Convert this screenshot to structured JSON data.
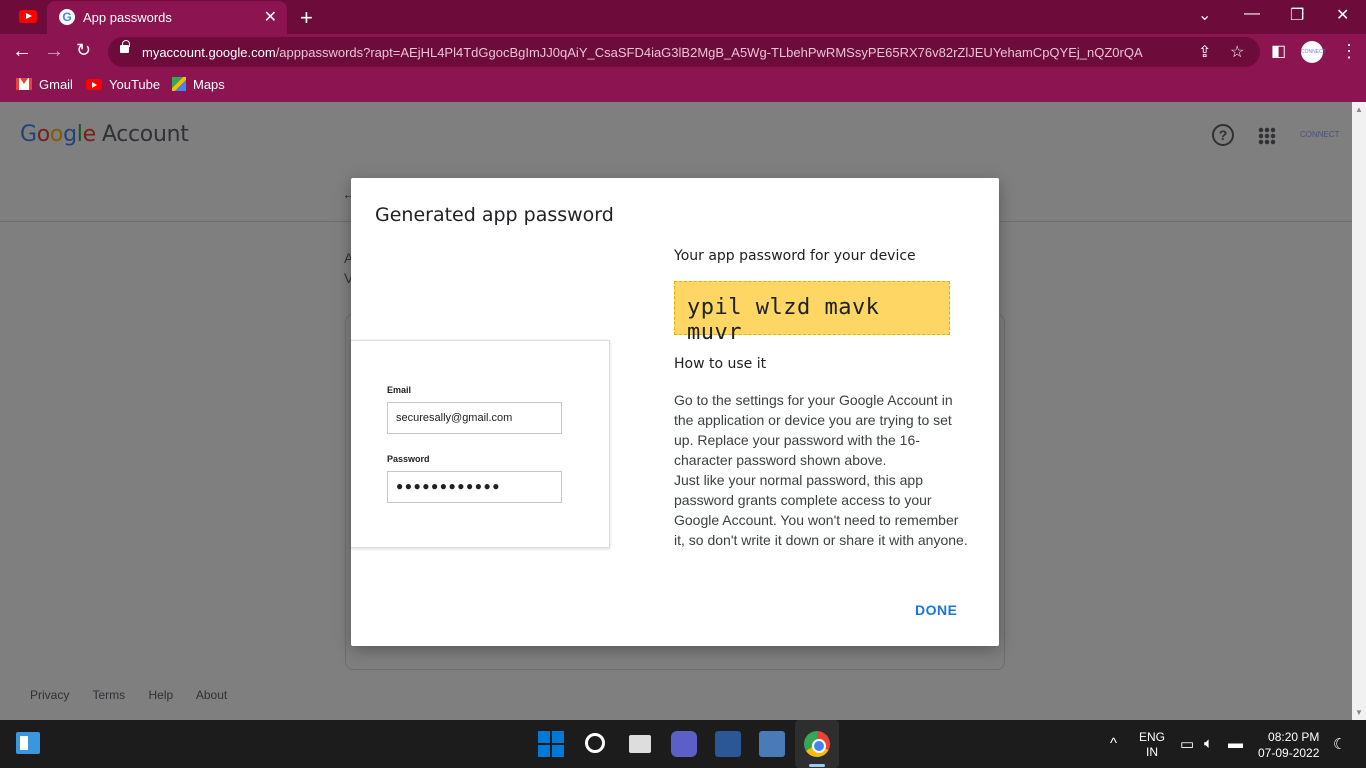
{
  "browser": {
    "tab_title": "App passwords",
    "url_host": "myaccount.google.com",
    "url_path": "/apppasswords?rapt=AEjHL4Pl4TdGgocBgImJJ0qAiY_CsaSFD4iaG3lB2MgB_A5Wg-TLbehPwRMSsyPE65RX76v82rZlJEUYehamCpQYEj_nQZ0rQA",
    "bookmarks": [
      "Gmail",
      "YouTube",
      "Maps"
    ]
  },
  "page": {
    "logo_google": "Google",
    "logo_account": "Account",
    "bg_text_1": "A",
    "bg_text_2": "V",
    "footer": [
      "Privacy",
      "Terms",
      "Help",
      "About"
    ]
  },
  "dialog": {
    "title": "Generated app password",
    "subtitle": "Your app password for your device",
    "password": "ypil wlzd mavk muvr",
    "how_to_title": "How to use it",
    "instructions_1": "Go to the settings for your Google Account in the application or device you are trying to set up. Replace your password with the 16-character password shown above.",
    "instructions_2": "Just like your normal password, this app password grants complete access to your Google Account. You won't need to remember it, so don't write it down or share it with anyone.",
    "done_label": "DONE",
    "preview": {
      "email_label": "Email",
      "email_value": "securesally@gmail.com",
      "password_label": "Password",
      "password_value": "●●●●●●●●●●●●"
    }
  },
  "taskbar": {
    "lang_1": "ENG",
    "lang_2": "IN",
    "time": "08:20 PM",
    "date": "07-09-2022"
  },
  "colors": {
    "chrome_frame": "#6d0c3a",
    "chrome_toolbar": "#8c1450",
    "password_highlight": "#fdd663",
    "done_blue": "#1a73e8"
  }
}
